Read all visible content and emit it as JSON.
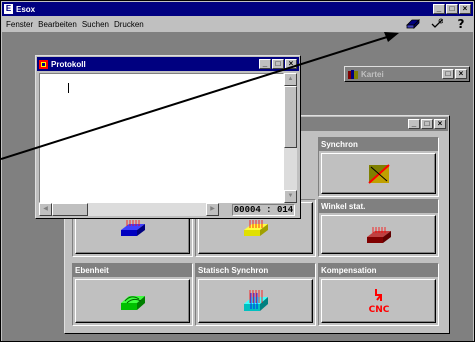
{
  "app": {
    "title": "Esox",
    "logo_letter": "E"
  },
  "window_controls": {
    "minimize": "_",
    "restore": "□",
    "close": "×"
  },
  "menu": [
    "Fenster",
    "Bearbeiten",
    "Suchen",
    "Drucken"
  ],
  "toolbar_icons": [
    "eraser-icon",
    "check-icon",
    "question-icon"
  ],
  "protokoll": {
    "title": "Protokoll",
    "text": "",
    "counter": "00004 : 014"
  },
  "kartei": {
    "title": "Kartei"
  },
  "measurement_panels": [
    {
      "label": "Synchron",
      "icon": "synchron-icon"
    },
    {
      "label": "",
      "icon": "flat-blue-block-icon"
    },
    {
      "label": "",
      "icon": "yellow-block-icon"
    },
    {
      "label": "Winkel stat.",
      "icon": "red-block-icon"
    },
    {
      "label": "Ebenheit",
      "icon": "green-block-icon"
    },
    {
      "label": "Statisch Synchron",
      "icon": "cyan-block-icon"
    },
    {
      "label": "Kompensation",
      "icon": "cnc-icon",
      "icon_text": "CNC"
    }
  ],
  "colors": {
    "title_active": "#000080",
    "title_inactive": "#808080",
    "face": "#c0c0c0",
    "workspace": "#808080"
  }
}
